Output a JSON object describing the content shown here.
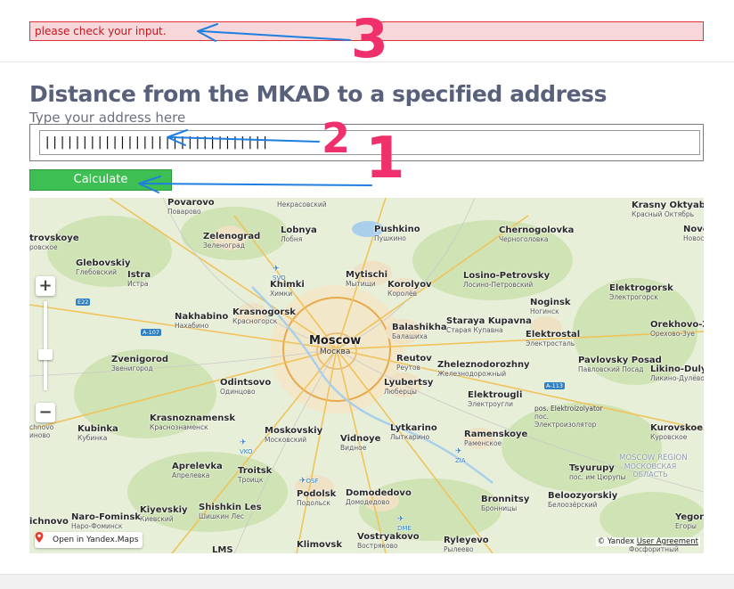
{
  "error": {
    "message": "please check your input."
  },
  "form": {
    "title": "Distance from the MKAD to a specified address",
    "address_label": "Type your address here",
    "address_value": "||||||||||||||||||||||||||||||",
    "calculate_label": "Calculate"
  },
  "map": {
    "labels": [
      {
        "id": "povarovo",
        "name": "Povarovo",
        "sub": "Поварово"
      },
      {
        "id": "nekrasovsky",
        "name": "",
        "sub": "Некрасовский"
      },
      {
        "id": "pushkino",
        "name": "Pushkino",
        "sub": "Пушкино"
      },
      {
        "id": "chernogolovka",
        "name": "Chernogolovka",
        "sub": "Черноголовка"
      },
      {
        "id": "krasny-oktyabr",
        "name": "Krasny Oktyabr",
        "sub": "Красный Октябрь"
      },
      {
        "id": "zelenograd",
        "name": "Zelenograd",
        "sub": "Зеленоград"
      },
      {
        "id": "lobnya",
        "name": "Lobnya",
        "sub": "Лобня"
      },
      {
        "id": "glebovskiy",
        "name": "Glebovskiy",
        "sub": "Глебовский"
      },
      {
        "id": "istra",
        "name": "Istra",
        "sub": "Истра"
      },
      {
        "id": "khimki",
        "name": "Khimki",
        "sub": "Химки"
      },
      {
        "id": "mytischi",
        "name": "Mytischi",
        "sub": "Мытищи"
      },
      {
        "id": "korolyov",
        "name": "Korolyov",
        "sub": "Королёв"
      },
      {
        "id": "losino",
        "name": "Losino-Petrovsky",
        "sub": "Лосино-Петровский"
      },
      {
        "id": "noginsk",
        "name": "Noginsk",
        "sub": "Ногинск"
      },
      {
        "id": "elektrogorsk",
        "name": "Elektrogorsk",
        "sub": "Электрогорск"
      },
      {
        "id": "nakhabino",
        "name": "Nakhabino",
        "sub": "Нахабино"
      },
      {
        "id": "krasnogorsk",
        "name": "Krasnogorsk",
        "sub": "Красногорск"
      },
      {
        "id": "balashikha",
        "name": "Balashikha",
        "sub": "Балашиха"
      },
      {
        "id": "kupavna",
        "name": "Staraya Kupavna",
        "sub": "Старая Купавна"
      },
      {
        "id": "elektrostal",
        "name": "Elektrostal",
        "sub": "Электросталь"
      },
      {
        "id": "orekhovo",
        "name": "Orekhovo-Zu",
        "sub": "Орехово-Зуе"
      },
      {
        "id": "zvenigorod",
        "name": "Zvenigorod",
        "sub": "Звенигород"
      },
      {
        "id": "reutov",
        "name": "Reutov",
        "sub": "Реутов"
      },
      {
        "id": "zheleznodorozhny",
        "name": "Zheleznodorozhny",
        "sub": "Железнодорожный"
      },
      {
        "id": "pavlovsky",
        "name": "Pavlovsky Posad",
        "sub": "Павловский Посад"
      },
      {
        "id": "likino",
        "name": "Likino-Dulyov",
        "sub": "Ликино-Дулёво"
      },
      {
        "id": "odintsovo",
        "name": "Odintsovo",
        "sub": "Одинцово"
      },
      {
        "id": "lyubertsy",
        "name": "Lyubertsy",
        "sub": "Люберцы"
      },
      {
        "id": "elektrougli",
        "name": "Elektrougli",
        "sub": "Электроугли"
      },
      {
        "id": "krasnoznamensk",
        "name": "Krasnoznamensk",
        "sub": "Краснознаменск"
      },
      {
        "id": "elektroizolyator",
        "name": "pos. Elektroizolyator",
        "sub": "пос. Электроизолятор"
      },
      {
        "id": "kubinka",
        "name": "Kubinka",
        "sub": "Кубинка"
      },
      {
        "id": "moskovskiy",
        "name": "Moskovskiy",
        "sub": "Московский"
      },
      {
        "id": "lytkarino",
        "name": "Lytkarino",
        "sub": "Лыткарино"
      },
      {
        "id": "ramenskoye",
        "name": "Ramenskoye",
        "sub": "Раменское"
      },
      {
        "id": "kurovskoe",
        "name": "Kurovskoe",
        "sub": "Куровское"
      },
      {
        "id": "vidnoye",
        "name": "Vidnoye",
        "sub": "Видное"
      },
      {
        "id": "aprelevka",
        "name": "Aprelevka",
        "sub": "Апрелевка"
      },
      {
        "id": "troitsk",
        "name": "Troitsk",
        "sub": "Троицк"
      },
      {
        "id": "tsyurupy",
        "name": "Tsyurupy",
        "sub": "пос. им Цюрупы"
      },
      {
        "id": "region",
        "name": "MOSCOW REGION",
        "sub": "МОСКОВСКАЯ ОБЛАСТЬ"
      },
      {
        "id": "podolsk",
        "name": "Podolsk",
        "sub": "Подольск"
      },
      {
        "id": "domodedovo",
        "name": "Domodedovo",
        "sub": "Домодедово"
      },
      {
        "id": "bronnitsy",
        "name": "Bronnitsy",
        "sub": "Бронницы"
      },
      {
        "id": "beloozyorskiy",
        "name": "Beloozyorskiy",
        "sub": "Белоозёрский"
      },
      {
        "id": "shishkin",
        "name": "Shishkin Les",
        "sub": "Шишкин Лес"
      },
      {
        "id": "kiyevskiy",
        "name": "Kiyevskiy",
        "sub": "Киевский"
      },
      {
        "id": "narofominsk",
        "name": "Naro-Fominsk",
        "sub": "Наро-Фоминск"
      },
      {
        "id": "vostryakovo",
        "name": "Vostryakovo",
        "sub": "Востряково"
      },
      {
        "id": "klimovsk",
        "name": "Klimovsk",
        "sub": ""
      },
      {
        "id": "ryleyevo",
        "name": "Ryleyevo",
        "sub": "Рылеево"
      },
      {
        "id": "yegory",
        "name": "Yegory",
        "sub": "Егоры"
      },
      {
        "id": "fosforitny",
        "name": "",
        "sub": "Фосфоритный"
      },
      {
        "id": "trovskoye",
        "name": "trovskoye",
        "sub": "ровское"
      },
      {
        "id": "novos",
        "name": "Novos",
        "sub": "Новос"
      },
      {
        "id": "chnovo",
        "name": "chnovo",
        "sub": "иново"
      },
      {
        "id": "ichnovo",
        "name": "ichnovo",
        "sub": ""
      },
      {
        "id": "lms",
        "name": "LMS",
        "sub": ""
      }
    ],
    "city": {
      "name": "Moscow",
      "sub": "Москва"
    },
    "airports": [
      "SVO",
      "VKO",
      "OSF",
      "DME",
      "ZIA"
    ],
    "roads": [
      "E22",
      "A-107",
      "A-113"
    ],
    "open_in_maps": "Open in Yandex.Maps",
    "copyright": "© Yandex",
    "user_agreement": "User Agreement",
    "zoom_in": "+",
    "zoom_out": "−"
  },
  "annotations": [
    "3",
    "2",
    "1"
  ],
  "colors": {
    "error_bg": "#f8d7da",
    "error_border": "#e0303a",
    "error_text": "#c4141e",
    "title": "#59607a",
    "button": "#3ebf53",
    "annotation": "#f0306a",
    "arrow": "#1f7fe0"
  }
}
